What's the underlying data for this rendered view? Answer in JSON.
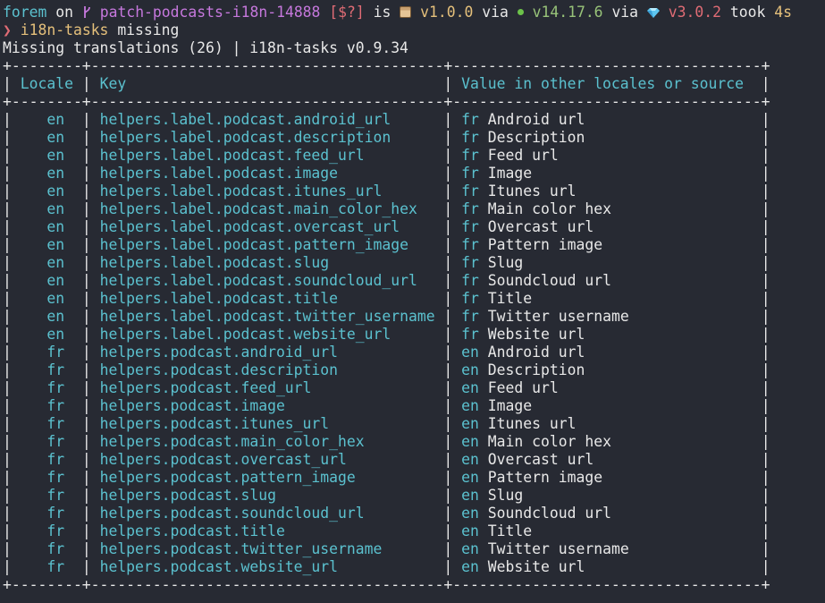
{
  "prompt": {
    "dir": "forem",
    "on": "on",
    "branch": "patch-podcasts-i18n-14888",
    "git_status": "[$?]",
    "is": "is",
    "pkg_version": "v1.0.0",
    "via1": "via",
    "node_version": "v14.17.6",
    "via2": "via",
    "ruby_version": "v3.0.2",
    "took": "took",
    "duration": "4s",
    "chevron": "❯",
    "command": "i18n-tasks",
    "command_arg": "missing"
  },
  "summary": "Missing translations (26) | i18n-tasks v0.9.34",
  "table": {
    "columns": [
      "Locale",
      "Key",
      "Value in other locales or source"
    ],
    "rows": [
      {
        "locale": "en",
        "key": "helpers.label.podcast.android_url",
        "src_locale": "fr",
        "value": "Android url"
      },
      {
        "locale": "en",
        "key": "helpers.label.podcast.description",
        "src_locale": "fr",
        "value": "Description"
      },
      {
        "locale": "en",
        "key": "helpers.label.podcast.feed_url",
        "src_locale": "fr",
        "value": "Feed url"
      },
      {
        "locale": "en",
        "key": "helpers.label.podcast.image",
        "src_locale": "fr",
        "value": "Image"
      },
      {
        "locale": "en",
        "key": "helpers.label.podcast.itunes_url",
        "src_locale": "fr",
        "value": "Itunes url"
      },
      {
        "locale": "en",
        "key": "helpers.label.podcast.main_color_hex",
        "src_locale": "fr",
        "value": "Main color hex"
      },
      {
        "locale": "en",
        "key": "helpers.label.podcast.overcast_url",
        "src_locale": "fr",
        "value": "Overcast url"
      },
      {
        "locale": "en",
        "key": "helpers.label.podcast.pattern_image",
        "src_locale": "fr",
        "value": "Pattern image"
      },
      {
        "locale": "en",
        "key": "helpers.label.podcast.slug",
        "src_locale": "fr",
        "value": "Slug"
      },
      {
        "locale": "en",
        "key": "helpers.label.podcast.soundcloud_url",
        "src_locale": "fr",
        "value": "Soundcloud url"
      },
      {
        "locale": "en",
        "key": "helpers.label.podcast.title",
        "src_locale": "fr",
        "value": "Title"
      },
      {
        "locale": "en",
        "key": "helpers.label.podcast.twitter_username",
        "src_locale": "fr",
        "value": "Twitter username"
      },
      {
        "locale": "en",
        "key": "helpers.label.podcast.website_url",
        "src_locale": "fr",
        "value": "Website url"
      },
      {
        "locale": "fr",
        "key": "helpers.podcast.android_url",
        "src_locale": "en",
        "value": "Android url"
      },
      {
        "locale": "fr",
        "key": "helpers.podcast.description",
        "src_locale": "en",
        "value": "Description"
      },
      {
        "locale": "fr",
        "key": "helpers.podcast.feed_url",
        "src_locale": "en",
        "value": "Feed url"
      },
      {
        "locale": "fr",
        "key": "helpers.podcast.image",
        "src_locale": "en",
        "value": "Image"
      },
      {
        "locale": "fr",
        "key": "helpers.podcast.itunes_url",
        "src_locale": "en",
        "value": "Itunes url"
      },
      {
        "locale": "fr",
        "key": "helpers.podcast.main_color_hex",
        "src_locale": "en",
        "value": "Main color hex"
      },
      {
        "locale": "fr",
        "key": "helpers.podcast.overcast_url",
        "src_locale": "en",
        "value": "Overcast url"
      },
      {
        "locale": "fr",
        "key": "helpers.podcast.pattern_image",
        "src_locale": "en",
        "value": "Pattern image"
      },
      {
        "locale": "fr",
        "key": "helpers.podcast.slug",
        "src_locale": "en",
        "value": "Slug"
      },
      {
        "locale": "fr",
        "key": "helpers.podcast.soundcloud_url",
        "src_locale": "en",
        "value": "Soundcloud url"
      },
      {
        "locale": "fr",
        "key": "helpers.podcast.title",
        "src_locale": "en",
        "value": "Title"
      },
      {
        "locale": "fr",
        "key": "helpers.podcast.twitter_username",
        "src_locale": "en",
        "value": "Twitter username"
      },
      {
        "locale": "fr",
        "key": "helpers.podcast.website_url",
        "src_locale": "en",
        "value": "Website url"
      }
    ]
  },
  "icons": {
    "branch": "git-branch-icon",
    "package": "package-icon",
    "node": "nodejs-icon",
    "ruby": "ruby-gem-icon"
  },
  "colors": {
    "background": "#272a33",
    "cyan": "#5bc1cf",
    "purple": "#c678dd",
    "red": "#e06c75",
    "yellow": "#e5c07b",
    "green": "#98c379",
    "foreground": "#e8e8e8"
  }
}
